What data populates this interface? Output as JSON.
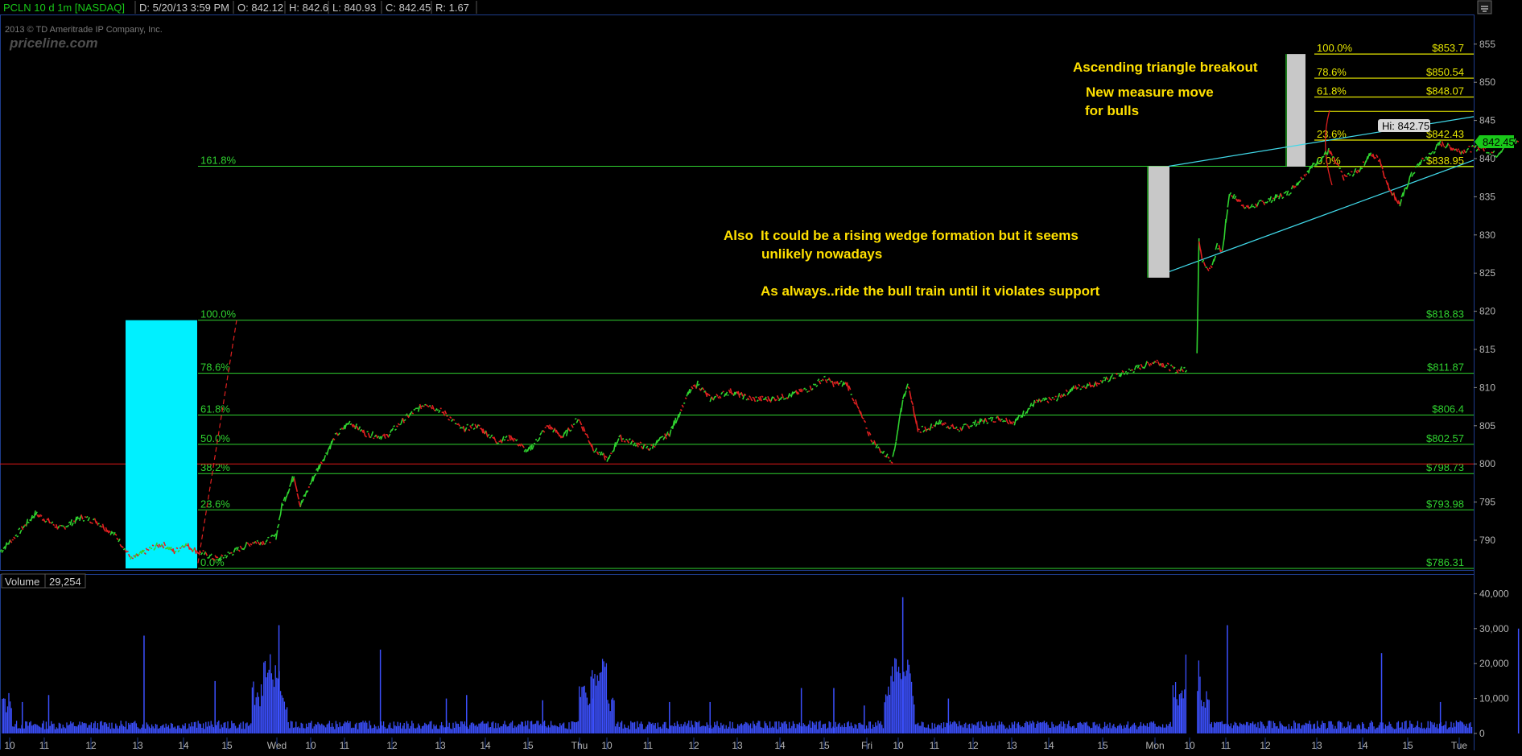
{
  "header": {
    "symbol": "PCLN 10 d 1m [NASDAQ]",
    "date": "D: 5/20/13 3:59 PM",
    "open": "O: 842.12",
    "high": "H: 842.6",
    "low": "L: 840.93",
    "close": "C: 842.45",
    "range": "R: 1.67"
  },
  "watermark": {
    "copyright": "2013 © TD Ameritrade IP Company, Inc.",
    "brand": "priceline.com"
  },
  "volume_header": {
    "label": "Volume",
    "value": "29,254"
  },
  "annotations": {
    "line1": "Ascending triangle breakout",
    "line2": "New measure move",
    "line3": "for bulls",
    "also": "Also",
    "line4": "It could be a rising wedge formation but it seems",
    "line5": "unlikely nowadays",
    "line6": "As always..ride the bull train until it violates support"
  },
  "colors": {
    "background": "#000000",
    "fib_main": "#2fd22f",
    "fib_yellow": "#e6e600",
    "up_candle": "#2fd22f",
    "down_candle": "#e02020",
    "box_cyan": "#00f0ff",
    "box_gray": "#c8c8c8",
    "trendline": "#40d8e8",
    "volume": "#3c50ff",
    "red_level": "#e01818",
    "annotation": "#ffe000",
    "last_price_badge": "#19c819"
  },
  "chart_data": [
    {
      "type": "line",
      "title": "PCLN 10 d 1m [NASDAQ]",
      "y_axis": {
        "ticks": [
          "855",
          "850",
          "845",
          "840",
          "835",
          "830",
          "825",
          "820",
          "815",
          "810",
          "805",
          "800",
          "795",
          "790"
        ],
        "range": [
          786,
          856
        ]
      },
      "x_axis": {
        "ticks": [
          "10",
          "11",
          "12",
          "13",
          "14",
          "15",
          "Wed",
          "10",
          "11",
          "12",
          "13",
          "14",
          "15",
          "Thu",
          "10",
          "11",
          "12",
          "13",
          "14",
          "15",
          "Fri",
          "10",
          "11",
          "12",
          "13",
          "14",
          "15",
          "Mon",
          "10",
          "11",
          "12",
          "13",
          "14",
          "15",
          "Tue"
        ]
      },
      "price_key_points": {
        "x": [
          0,
          15,
          35,
          60,
          80,
          95,
          115,
          130,
          150,
          160,
          172,
          182,
          195,
          215,
          235,
          250,
          262,
          272,
          278,
          290,
          296,
          310,
          330,
          345,
          360,
          380,
          400,
          420,
          440,
          455,
          470,
          490,
          505,
          520,
          540,
          555,
          570,
          585,
          600,
          610,
          620,
          640,
          660,
          680,
          688,
          700,
          720,
          740,
          760,
          780,
          800,
          812,
          822,
          835,
          850,
          860,
          870,
          880,
          890,
          895,
          905,
          915,
          925,
          945,
          965,
          985,
          1000,
          1020,
          1040,
          1060,
          1080,
          1100,
          1120,
          1140,
          1160,
          1170,
          1180,
          1182,
          1185,
          1190,
          1195,
          1200,
          1205,
          1212,
          1230,
          1250,
          1270,
          1290,
          1310,
          1325,
          1340,
          1350,
          1360,
          1368,
          1380,
          1390,
          1400,
          1410,
          1420,
          1440,
          1460,
          1475,
          1485,
          1497
        ],
        "y": [
          788.5,
          790.5,
          793.5,
          791.5,
          793,
          792.5,
          790.5,
          787.5,
          789,
          789.5,
          788.5,
          789.5,
          788.5,
          787.5,
          788.8,
          789.8,
          789.8,
          790.5,
          794.5,
          798.5,
          794.5,
          798.5,
          803.5,
          805.5,
          804,
          803.5,
          806,
          808,
          806.5,
          804.5,
          805,
          803,
          803.5,
          801.5,
          805,
          803.5,
          806,
          802,
          800.5,
          803.5,
          803,
          802,
          804,
          809.5,
          810.5,
          808.5,
          809.5,
          808.5,
          808.5,
          809,
          810,
          811.2,
          810.5,
          810.5,
          806,
          803,
          801.5,
          800.5,
          808.5,
          810.5,
          804.5,
          804.5,
          805.5,
          804.5,
          805.5,
          806,
          805.5,
          808,
          808.5,
          810,
          810.5,
          811.5,
          812.5,
          813.5,
          812.2,
          812.5,
          814.5,
          829.5,
          826.8,
          825.5,
          826,
          828.5,
          827.8,
          835.5,
          833.5,
          834.5,
          835.5,
          838.5,
          841,
          837.5,
          838.5,
          840.5,
          840,
          836.5,
          834,
          837.5,
          839.5,
          840.5,
          842,
          841,
          841.5,
          840.5,
          841.8,
          842.45
        ]
      },
      "levels": [
        {
          "label": "161.8%",
          "price": 839.0
        },
        {
          "label": "100.0%",
          "value": "$818.83",
          "price": 818.83
        },
        {
          "label": "78.6%",
          "value": "$811.87",
          "price": 811.87
        },
        {
          "label": "61.8%",
          "value": "$806.4",
          "price": 806.4
        },
        {
          "label": "50.0%",
          "value": "$802.57",
          "price": 802.57
        },
        {
          "label": "38.2%",
          "value": "$798.73",
          "price": 798.73
        },
        {
          "label": "23.6%",
          "value": "$793.98",
          "price": 793.98
        },
        {
          "label": "0.0%",
          "value": "$786.31",
          "price": 786.31
        }
      ],
      "levels_upper": [
        {
          "label": "100.0%",
          "value": "$853.7",
          "price": 853.7
        },
        {
          "label": "78.6%",
          "value": "$850.54",
          "price": 850.54
        },
        {
          "label": "61.8%",
          "value": "$848.07",
          "price": 848.07
        },
        {
          "label": "23.6%",
          "value": "$842.43",
          "price": 842.43
        },
        {
          "label": "0.0%",
          "value": "$838.95",
          "price": 838.95
        }
      ],
      "red_level": 800.0,
      "high_label": "Hi: 842.75",
      "last_price": "842.45"
    },
    {
      "type": "bar",
      "title": "Volume",
      "y_axis": {
        "ticks": [
          "40,000",
          "30,000",
          "20,000",
          "10,000",
          "0"
        ],
        "range": [
          0,
          40000
        ]
      },
      "spikes": {
        "x": [
          22,
          48,
          142,
          212,
          275,
          375,
          440,
          460,
          535,
          585,
          660,
          700,
          790,
          822,
          852,
          890,
          935,
          1165,
          1210,
          1362,
          1420,
          1497
        ],
        "values": [
          9000,
          11000,
          28000,
          15000,
          31000,
          24000,
          10000,
          11000,
          9500,
          10000,
          9000,
          9000,
          13000,
          13000,
          8000,
          39000,
          10000,
          10000,
          31000,
          23000,
          9000,
          30000
        ]
      },
      "last_value": 29254
    }
  ]
}
